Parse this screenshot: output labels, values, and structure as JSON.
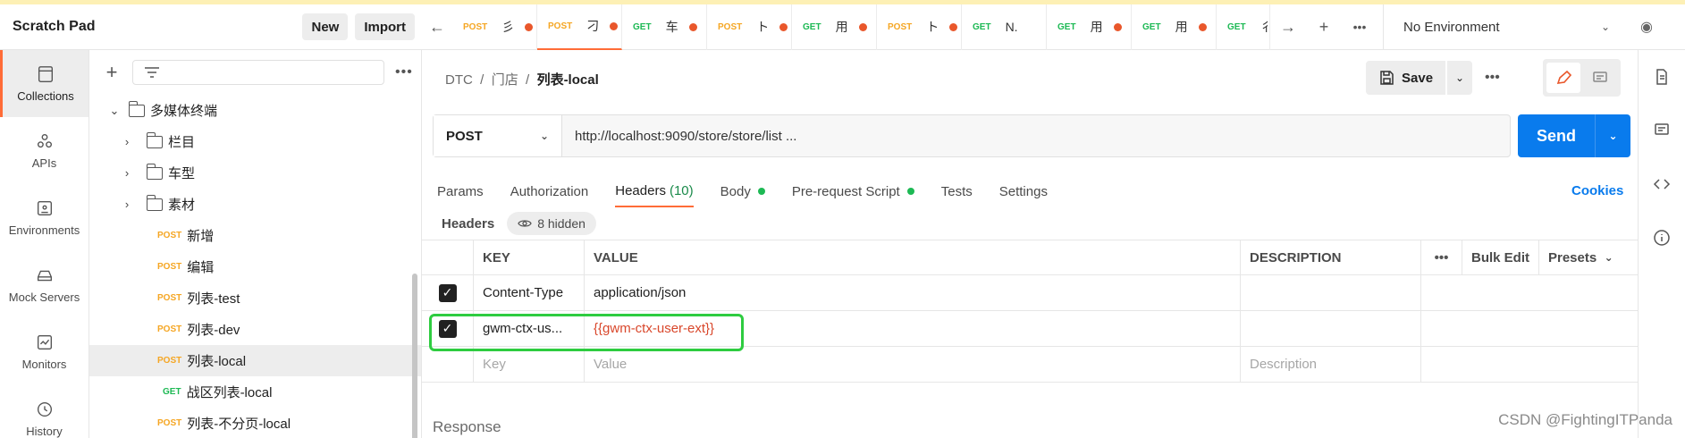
{
  "workspace": {
    "title": "Scratch Pad",
    "new_label": "New",
    "import_label": "Import"
  },
  "rail": [
    {
      "label": "Collections",
      "icon": "collections-icon"
    },
    {
      "label": "APIs",
      "icon": "apis-icon"
    },
    {
      "label": "Environments",
      "icon": "environments-icon"
    },
    {
      "label": "Mock Servers",
      "icon": "mock-servers-icon"
    },
    {
      "label": "Monitors",
      "icon": "monitors-icon"
    },
    {
      "label": "History",
      "icon": "history-icon"
    }
  ],
  "tree": {
    "items": [
      {
        "type": "folder",
        "name": "多媒体终端",
        "expanded": true
      },
      {
        "type": "folder",
        "name": "栏目"
      },
      {
        "type": "folder",
        "name": "车型"
      },
      {
        "type": "folder",
        "name": "素材"
      },
      {
        "type": "request",
        "method": "POST",
        "name": "新增"
      },
      {
        "type": "request",
        "method": "POST",
        "name": "编辑"
      },
      {
        "type": "request",
        "method": "POST",
        "name": "列表-test"
      },
      {
        "type": "request",
        "method": "POST",
        "name": "列表-dev"
      },
      {
        "type": "request",
        "method": "POST",
        "name": "列表-local",
        "selected": true
      },
      {
        "type": "request",
        "method": "GET",
        "name": "战区列表-local"
      },
      {
        "type": "request",
        "method": "POST",
        "name": "列表-不分页-local"
      }
    ]
  },
  "tabs": [
    {
      "method": "POST",
      "name": "彡"
    },
    {
      "method": "POST",
      "name": "刁"
    },
    {
      "method": "GET",
      "name": "车"
    },
    {
      "method": "POST",
      "name": "ト"
    },
    {
      "method": "GET",
      "name": "用"
    },
    {
      "method": "POST",
      "name": "ト"
    },
    {
      "method": "GET",
      "name": "N."
    },
    {
      "method": "GET",
      "name": "用"
    },
    {
      "method": "GET",
      "name": "用"
    },
    {
      "method": "GET",
      "name": "彳"
    }
  ],
  "environment": {
    "label": "No Environment"
  },
  "breadcrumb": {
    "part1": "DTC",
    "sep": "/",
    "part2": "门店",
    "current": "列表-local"
  },
  "toolbar": {
    "save_label": "Save"
  },
  "request": {
    "method": "POST",
    "url": "http://localhost:9090/store/store/list ..."
  },
  "send_label": "Send",
  "request_tabs": {
    "params": "Params",
    "authorization": "Authorization",
    "headers": "Headers",
    "headers_count": "(10)",
    "body": "Body",
    "prerequest": "Pre-request Script",
    "tests": "Tests",
    "settings": "Settings"
  },
  "cookies_label": "Cookies",
  "headers_section": {
    "title": "Headers",
    "hidden": "8 hidden"
  },
  "table": {
    "columns": {
      "key": "KEY",
      "value": "VALUE",
      "description": "DESCRIPTION",
      "bulk_edit": "Bulk Edit",
      "presets": "Presets"
    },
    "rows": [
      {
        "key": "Content-Type",
        "value": "application/json",
        "checked": true
      },
      {
        "key": "gwm-ctx-us...",
        "value": "{{gwm-ctx-user-ext}}",
        "checked": true
      }
    ],
    "placeholders": {
      "key": "Key",
      "value": "Value",
      "description": "Description"
    }
  },
  "response_label": "Response",
  "watermark": "CSDN @FightingITPanda"
}
